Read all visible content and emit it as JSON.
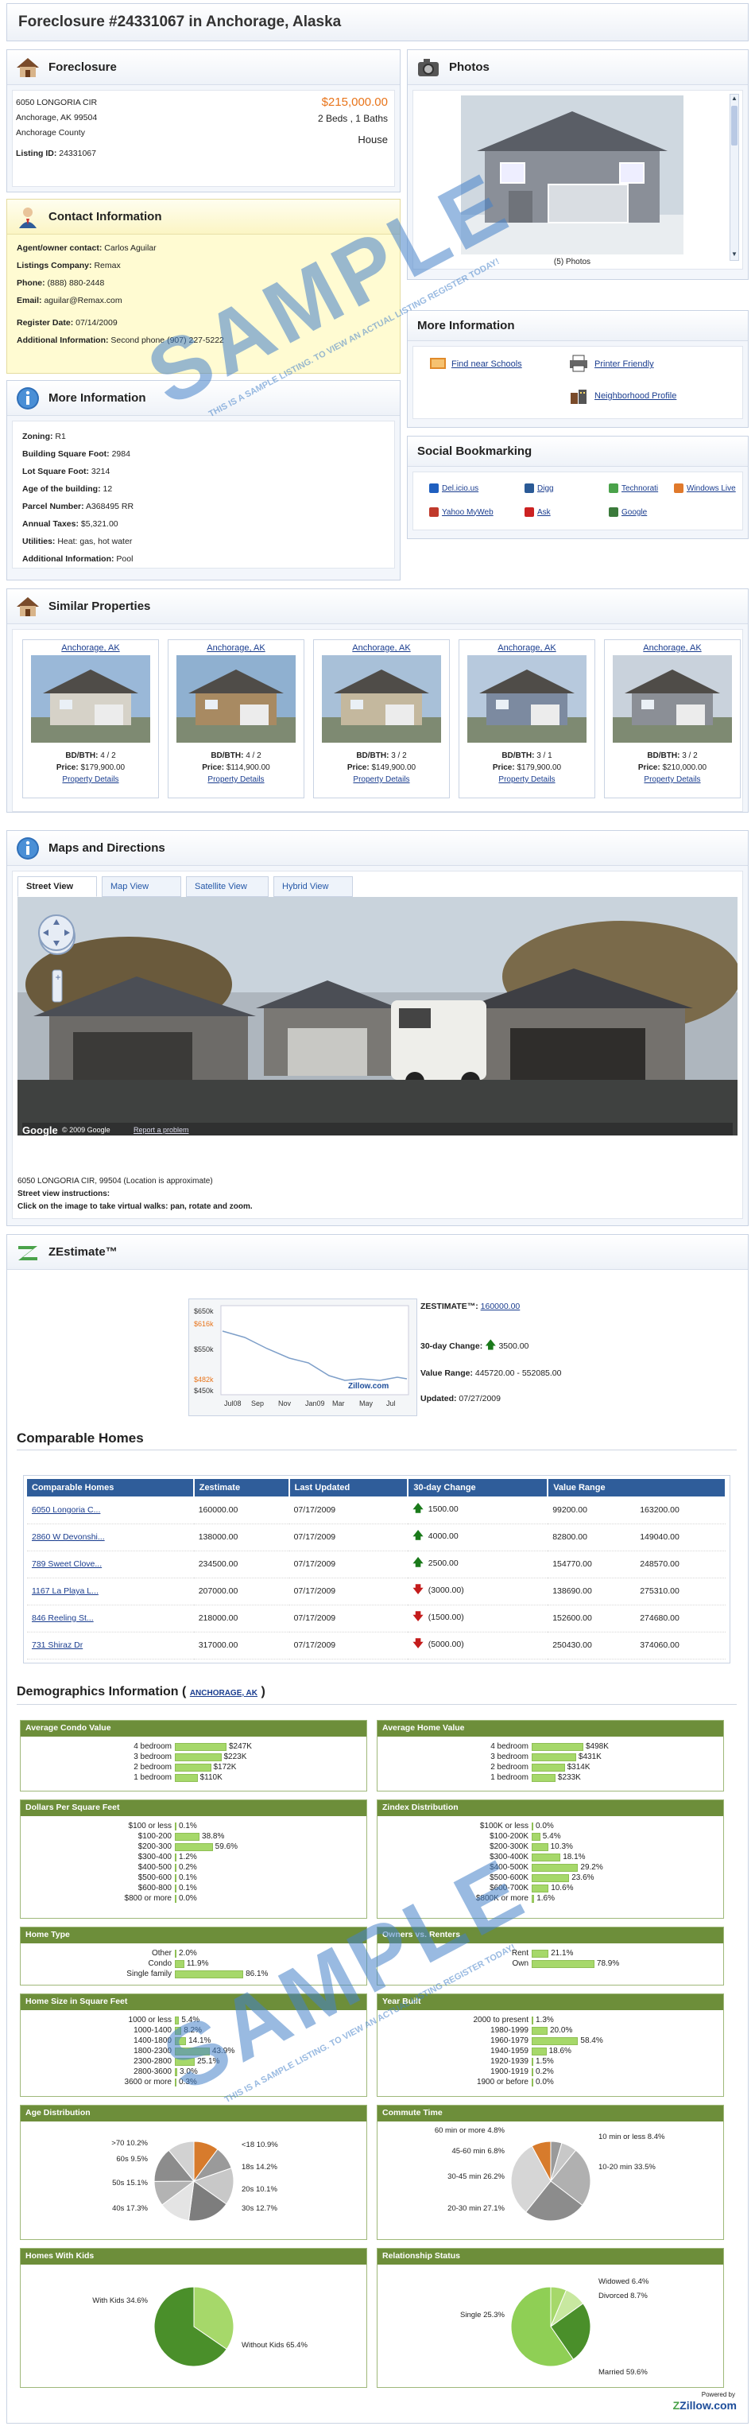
{
  "page_title": "Foreclosure #24331067 in Anchorage, Alaska",
  "foreclosure": {
    "heading": "Foreclosure",
    "address1": "6050 LONGORIA CIR",
    "address2": "Anchorage, AK 99504",
    "county": "Anchorage County",
    "price": "$215,000.00",
    "beds_baths": "2 Beds , 1 Baths",
    "type": "House",
    "listing_id_label": "Listing ID:",
    "listing_id": "24331067"
  },
  "photos": {
    "heading": "Photos",
    "caption": "(5) Photos"
  },
  "contact": {
    "heading": "Contact Information",
    "fields": [
      {
        "label": "Agent/owner contact:",
        "value": "Carlos Aguilar"
      },
      {
        "label": "Listings Company:",
        "value": "Remax"
      },
      {
        "label": "Phone:",
        "value": "(888) 880-2448"
      },
      {
        "label": "Email:",
        "value": "aguilar@Remax.com"
      },
      {
        "label": "Register Date:",
        "value": "07/14/2009"
      },
      {
        "label": "Additional Information:",
        "value": "Second phone (907) 227-5222"
      }
    ]
  },
  "more_info_links": {
    "heading": "More Information",
    "schools": "Find near Schools",
    "printer": "Printer Friendly",
    "neighborhood": "Neighborhood Profile"
  },
  "more_info": {
    "heading": "More Information",
    "fields": [
      {
        "label": "Zoning:",
        "value": "R1"
      },
      {
        "label": "Building Square Foot:",
        "value": "2984"
      },
      {
        "label": "Lot Square Foot:",
        "value": "3214"
      },
      {
        "label": "Age of the building:",
        "value": "12"
      },
      {
        "label": "Parcel Number:",
        "value": "A368495 RR"
      },
      {
        "label": "Annual Taxes:",
        "value": "$5,321.00"
      },
      {
        "label": "Utilities:",
        "value": "Heat: gas, hot water"
      },
      {
        "label": "Additional Information:",
        "value": "Pool"
      }
    ]
  },
  "social": {
    "heading": "Social Bookmarking",
    "items": [
      "Del.icio.us",
      "Digg",
      "Technorati",
      "Windows Live",
      "Yahoo MyWeb",
      "Ask",
      "Google"
    ]
  },
  "similar": {
    "heading": "Similar Properties",
    "bd_label": "BD/BTH:",
    "price_label": "Price:",
    "details_label": "Property Details",
    "items": [
      {
        "city": "Anchorage, AK",
        "bdbth": "4 / 2",
        "price": "$179,900.00"
      },
      {
        "city": "Anchorage, AK",
        "bdbth": "4 / 2",
        "price": "$114,900.00"
      },
      {
        "city": "Anchorage, AK",
        "bdbth": "3 / 2",
        "price": "$149,900.00"
      },
      {
        "city": "Anchorage, AK",
        "bdbth": "3 / 1",
        "price": "$179,900.00"
      },
      {
        "city": "Anchorage, AK",
        "bdbth": "3 / 2",
        "price": "$210,000.00"
      }
    ]
  },
  "maps": {
    "heading": "Maps and Directions",
    "tabs": [
      "Street View",
      "Map View",
      "Satellite View",
      "Hybrid View"
    ],
    "google_label": "Google",
    "copyright": "© 2009 Google",
    "report": "Report a problem",
    "location_text": "6050 LONGORIA CIR, 99504 (Location is approximate)",
    "instructions_title": "Street view instructions:",
    "instructions": "Click on the image to take virtual walks: pan, rotate and zoom."
  },
  "zestimate": {
    "heading": "ZEstimate™",
    "chart_ticks": [
      "$650k",
      "$616k",
      "$550k",
      "$482k",
      "$450k"
    ],
    "chart_months": [
      "Jul08",
      "Sep",
      "Nov",
      "Jan09",
      "Mar",
      "May",
      "Jul"
    ],
    "zillow_label": "Zillow.com",
    "zestimate_label": "ZESTIMATE™:",
    "zestimate_value": "160000.00",
    "change_label": "30-day Change:",
    "change_value": "3500.00",
    "range_label": "Value Range:",
    "range_value": "445720.00 - 552085.00",
    "updated_label": "Updated:",
    "updated_value": "07/27/2009"
  },
  "comparable": {
    "heading": "Comparable Homes",
    "headers": [
      "Comparable Homes",
      "Zestimate",
      "Last Updated",
      "30-day Change",
      "Value Range"
    ],
    "rows": [
      {
        "name": "6050 Longoria C...",
        "z": "160000.00",
        "date": "07/17/2009",
        "change": "1500.00",
        "dir": "up",
        "low": "99200.00",
        "high": "163200.00"
      },
      {
        "name": "2860 W Devonshi...",
        "z": "138000.00",
        "date": "07/17/2009",
        "change": "4000.00",
        "dir": "up",
        "low": "82800.00",
        "high": "149040.00"
      },
      {
        "name": "789 Sweet Clove...",
        "z": "234500.00",
        "date": "07/17/2009",
        "change": "2500.00",
        "dir": "up",
        "low": "154770.00",
        "high": "248570.00"
      },
      {
        "name": "1167 La Playa L...",
        "z": "207000.00",
        "date": "07/17/2009",
        "change": "(3000.00)",
        "dir": "down",
        "low": "138690.00",
        "high": "275310.00"
      },
      {
        "name": "846 Reeling St...",
        "z": "218000.00",
        "date": "07/17/2009",
        "change": "(1500.00)",
        "dir": "down",
        "low": "152600.00",
        "high": "274680.00"
      },
      {
        "name": "731 Shiraz Dr",
        "z": "317000.00",
        "date": "07/17/2009",
        "change": "(5000.00)",
        "dir": "down",
        "low": "250430.00",
        "high": "374060.00"
      }
    ]
  },
  "demographics": {
    "heading": "Demographics Information (",
    "heading_end": ")",
    "link": "ANCHORAGE, AK",
    "powered_by": "Powered by",
    "zillow": "Zillow.com",
    "condo": {
      "title": "Average Condo Value",
      "rows": [
        [
          "4 bedroom",
          "$247K",
          0.5
        ],
        [
          "3 bedroom",
          "$223K",
          0.45
        ],
        [
          "2 bedroom",
          "$172K",
          0.35
        ],
        [
          "1 bedroom",
          "$110K",
          0.22
        ]
      ]
    },
    "home": {
      "title": "Average Home Value",
      "rows": [
        [
          "4 bedroom",
          "$498K",
          0.5
        ],
        [
          "3 bedroom",
          "$431K",
          0.43
        ],
        [
          "2 bedroom",
          "$314K",
          0.32
        ],
        [
          "1 bedroom",
          "$233K",
          0.23
        ]
      ]
    },
    "dpsf": {
      "title": "Dollars Per Square Feet",
      "rows": [
        [
          "$100 or less",
          "0.1%",
          0.001
        ],
        [
          "$100-200",
          "38.8%",
          0.388
        ],
        [
          "$200-300",
          "59.6%",
          0.596
        ],
        [
          "$300-400",
          "1.2%",
          0.012
        ],
        [
          "$400-500",
          "0.2%",
          0.002
        ],
        [
          "$500-600",
          "0.1%",
          0.001
        ],
        [
          "$600-800",
          "0.1%",
          0.001
        ],
        [
          "$800 or more",
          "0.0%",
          0.0
        ]
      ]
    },
    "zindex": {
      "title": "Zindex Distribution",
      "rows": [
        [
          "$100K or less",
          "0.0%",
          0.0
        ],
        [
          "$100-200K",
          "5.4%",
          0.054
        ],
        [
          "$200-300K",
          "10.3%",
          0.103
        ],
        [
          "$300-400K",
          "18.1%",
          0.181
        ],
        [
          "$400-500K",
          "29.2%",
          0.292
        ],
        [
          "$500-600K",
          "23.6%",
          0.236
        ],
        [
          "$600-700K",
          "10.6%",
          0.106
        ],
        [
          "$800K or more",
          "1.6%",
          0.016
        ]
      ]
    },
    "hometype": {
      "title": "Home Type",
      "rows": [
        [
          "Other",
          "2.0%",
          0.02
        ],
        [
          "Condo",
          "11.9%",
          0.119
        ],
        [
          "Single family",
          "86.1%",
          0.861
        ]
      ]
    },
    "owners": {
      "title": "Owners vs. Renters",
      "rows": [
        [
          "Rent",
          "21.1%",
          0.211
        ],
        [
          "Own",
          "78.9%",
          0.789
        ]
      ]
    },
    "homesize": {
      "title": "Home Size in Square Feet",
      "rows": [
        [
          "1000 or less",
          "5.4%",
          0.054
        ],
        [
          "1000-1400",
          "8.2%",
          0.082
        ],
        [
          "1400-1800",
          "14.1%",
          0.141
        ],
        [
          "1800-2300",
          "43.9%",
          0.439
        ],
        [
          "2300-2800",
          "25.1%",
          0.251
        ],
        [
          "2800-3600",
          "3.0%",
          0.03
        ],
        [
          "3600 or more",
          "0.3%",
          0.003
        ]
      ]
    },
    "yearbuilt": {
      "title": "Year Built",
      "rows": [
        [
          "2000 to present",
          "1.3%",
          0.013
        ],
        [
          "1980-1999",
          "20.0%",
          0.2
        ],
        [
          "1960-1979",
          "58.4%",
          0.584
        ],
        [
          "1940-1959",
          "18.6%",
          0.186
        ],
        [
          "1920-1939",
          "1.5%",
          0.015
        ],
        [
          "1900-1919",
          "0.2%",
          0.002
        ],
        [
          "1900 or before",
          "0.0%",
          0.0
        ]
      ]
    },
    "age": {
      "title": "Age Distribution",
      "labels": [
        ">70 10.2%",
        "60s 9.5%",
        "50s 15.1%",
        "40s 17.3%",
        "30s 12.7%",
        "20s 10.1%",
        "18s 14.2%",
        "<18 10.9%"
      ],
      "values": [
        10.2,
        9.5,
        15.1,
        17.3,
        12.7,
        10.1,
        14.2,
        10.9
      ]
    },
    "commute": {
      "title": "Commute Time",
      "labels": [
        "60 min or more 4.8%",
        "45-60 min 6.8%",
        "30-45 min 26.2%",
        "20-30 min 27.1%",
        "10-20 min 33.5%",
        "10 min or less 8.4%"
      ],
      "values": [
        4.8,
        6.8,
        26.2,
        27.1,
        33.5,
        8.4
      ]
    },
    "kids": {
      "title": "Homes With Kids",
      "labels": [
        "With Kids 34.6%",
        "Without Kids 65.4%"
      ],
      "values": [
        34.6,
        65.4
      ]
    },
    "relationship": {
      "title": "Relationship Status",
      "labels": [
        "Widowed 6.4%",
        "Divorced 8.7%",
        "Single 25.3%",
        "Married 59.6%"
      ],
      "values": [
        6.4,
        8.7,
        25.3,
        59.6
      ]
    }
  },
  "watermark": {
    "word": "SAMPLE",
    "line": "THIS IS A SAMPLE LISTING. TO VIEW AN ACTUAL LISTING REGISTER TODAY!"
  },
  "colors": {
    "price": "#e8741a",
    "header_blue": "#2f5d9a",
    "demo_green": "#6d8e3a",
    "bar_green": "#a6d86a",
    "contact_bg": "#fffbd2"
  }
}
